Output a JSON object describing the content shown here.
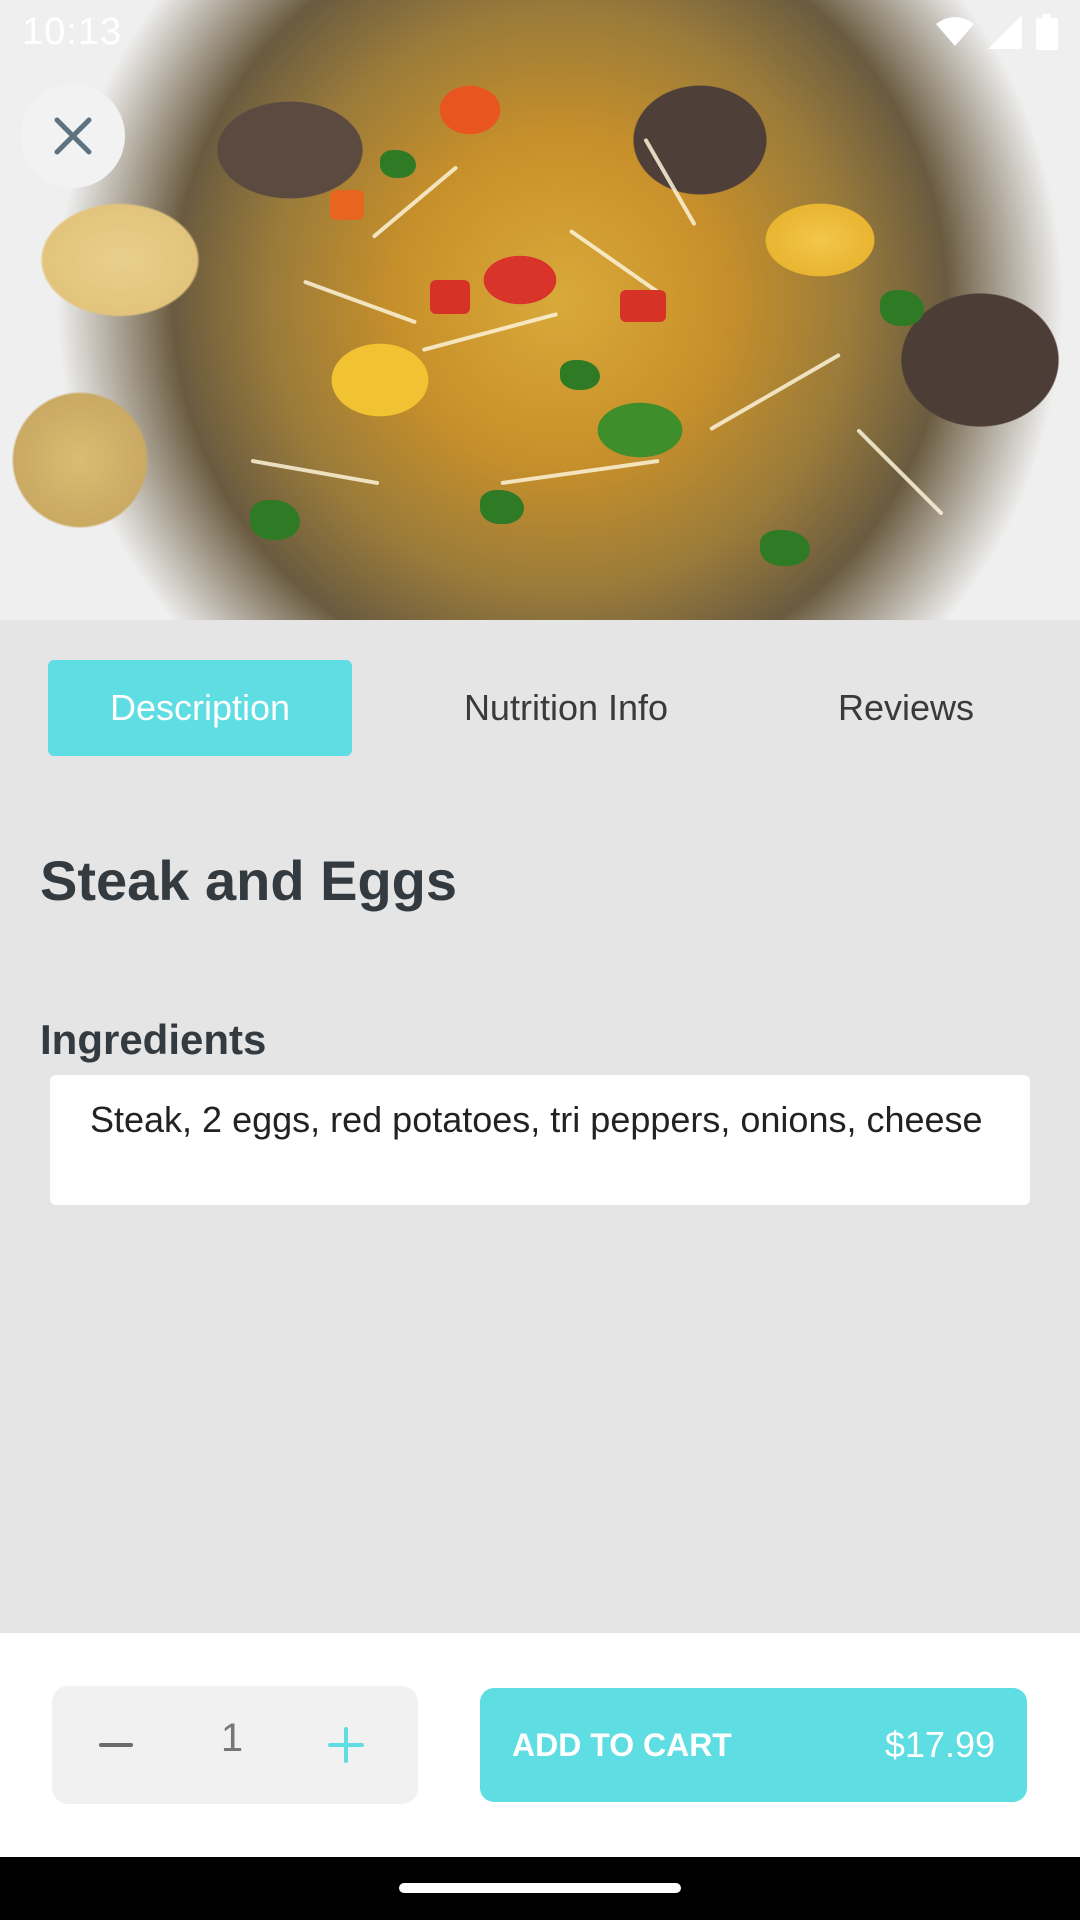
{
  "status_bar": {
    "time": "10:13",
    "icons": [
      "wifi-icon",
      "signal-icon",
      "battery-icon"
    ]
  },
  "hero": {
    "icon": "close-icon"
  },
  "tabs": [
    {
      "label": "Description",
      "active": true
    },
    {
      "label": "Nutrition Info",
      "active": false
    },
    {
      "label": "Reviews",
      "active": false
    }
  ],
  "dish": {
    "title": "Steak and Eggs",
    "ingredients_label": "Ingredients",
    "ingredients": "Steak, 2 eggs, red potatoes, tri peppers, onions, cheese"
  },
  "order": {
    "quantity": "1",
    "add_to_cart_label": "ADD TO CART",
    "price": "$17.99"
  },
  "colors": {
    "accent": "#5edde3",
    "background": "#e5e5e5",
    "title_text": "#333a40"
  }
}
